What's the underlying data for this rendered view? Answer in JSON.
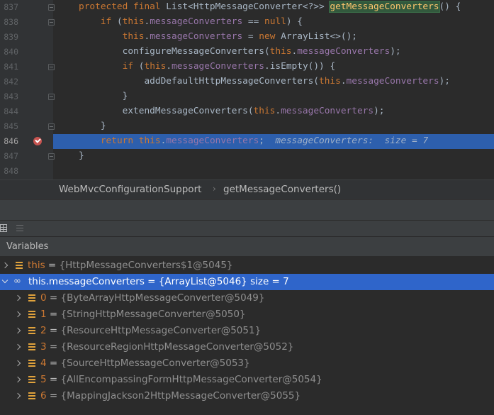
{
  "editor": {
    "lines": [
      {
        "num": "837",
        "html": "<span class=\"kw\">protected final </span>List&lt;HttpMessageConverter&lt;?&gt;&gt; <span class=\"hlm\">getMessageConverters</span>() {"
      },
      {
        "num": "838",
        "html": "    <span class=\"kw\">if </span>(<span class=\"kw\">this</span>.<span class=\"fld\">messageConverters</span> == <span class=\"kw\">null</span>) {"
      },
      {
        "num": "839",
        "html": "        <span class=\"kw\">this</span>.<span class=\"fld\">messageConverters</span> = <span class=\"kw\">new </span>ArrayList&lt;&gt;();"
      },
      {
        "num": "840",
        "html": "        configureMessageConverters(<span class=\"kw\">this</span>.<span class=\"fld\">messageConverters</span>);"
      },
      {
        "num": "841",
        "html": "        <span class=\"kw\">if </span>(<span class=\"kw\">this</span>.<span class=\"fld\">messageConverters</span>.isEmpty()) {"
      },
      {
        "num": "842",
        "html": "            addDefaultHttpMessageConverters(<span class=\"kw\">this</span>.<span class=\"fld\">messageConverters</span>);"
      },
      {
        "num": "843",
        "html": "        }"
      },
      {
        "num": "844",
        "html": "        extendMessageConverters(<span class=\"kw\">this</span>.<span class=\"fld\">messageConverters</span>);"
      },
      {
        "num": "845",
        "html": "    }"
      },
      {
        "num": "846",
        "html": "    <span class=\"kw\">return </span><span class=\"kw\">this</span>.<span class=\"fld\">messageConverters</span>;  <span class=\"hint\">messageConverters:  size = 7</span>"
      },
      {
        "num": "847",
        "html": "}"
      },
      {
        "num": "848",
        "html": ""
      }
    ],
    "current_line": "846",
    "inline_hint": "messageConverters:  size = 7"
  },
  "breadcrumb": {
    "class_name": "WebMvcConfigurationSupport",
    "method_name": "getMessageConverters()"
  },
  "panel": {
    "title": "Variables"
  },
  "variables": [
    {
      "name": "this",
      "value": "{HttpMessageConverters$1@5045}",
      "expanded": false,
      "kind": "field"
    },
    {
      "name": "this.messageConverters",
      "value": "{ArrayList@5046}",
      "suffix": "size = 7",
      "expanded": true,
      "kind": "watch",
      "selected": true
    },
    {
      "name": "0",
      "value": "{ByteArrayHttpMessageConverter@5049}",
      "child": true
    },
    {
      "name": "1",
      "value": "{StringHttpMessageConverter@5050}",
      "child": true
    },
    {
      "name": "2",
      "value": "{ResourceHttpMessageConverter@5051}",
      "child": true
    },
    {
      "name": "3",
      "value": "{ResourceRegionHttpMessageConverter@5052}",
      "child": true
    },
    {
      "name": "4",
      "value": "{SourceHttpMessageConverter@5053}",
      "child": true
    },
    {
      "name": "5",
      "value": "{AllEncompassingFormHttpMessageConverter@5054}",
      "child": true
    },
    {
      "name": "6",
      "value": "{MappingJackson2HttpMessageConverter@5055}",
      "child": true
    }
  ],
  "colors": {
    "editor_bg": "#2b2b2b",
    "selection": "#2f65ca",
    "exec_line": "#2d5fad",
    "keyword": "#cc7832",
    "field": "#9876aa",
    "breakpoint": "#c75450"
  }
}
